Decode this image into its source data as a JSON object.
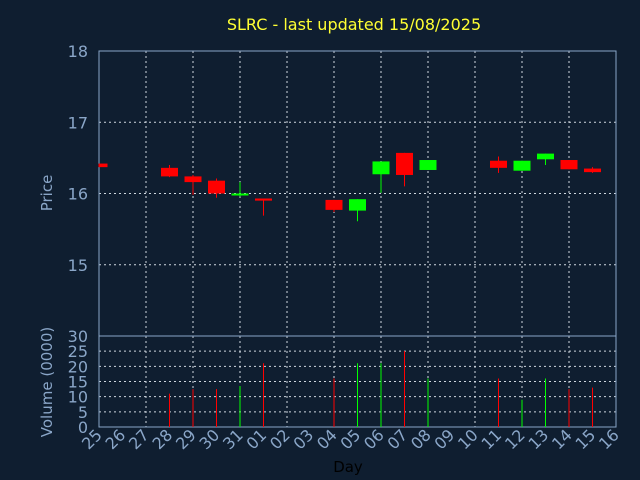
{
  "chart_data": {
    "type": "candlestick",
    "title": "SLRC - last updated 15/08/2025",
    "ylabel": "Price",
    "volume_ylabel": "Volume (0000)",
    "xlabel": "Day",
    "x_ticks": [
      "25",
      "26",
      "27",
      "28",
      "29",
      "30",
      "31",
      "01",
      "02",
      "03",
      "04",
      "05",
      "06",
      "07",
      "08",
      "09",
      "10",
      "11",
      "12",
      "13",
      "14",
      "15",
      "16"
    ],
    "price_ticks": [
      15,
      16,
      17,
      18
    ],
    "price_ylim": [
      14.0,
      18.0
    ],
    "volume_ticks": [
      0,
      5,
      10,
      15,
      20,
      25,
      30
    ],
    "volume_ylim": [
      0,
      30
    ],
    "grid": true,
    "colors": {
      "up": "#00ff00",
      "down": "#ff0000",
      "grid": "#d0d8e0",
      "frame": "#8aa6c8",
      "background": "#0f1e30"
    },
    "candles": [
      {
        "day": "25",
        "open": 16.42,
        "high": 16.42,
        "low": 16.37,
        "close": 16.37,
        "volume": null
      },
      {
        "day": "28",
        "open": 16.36,
        "high": 16.4,
        "low": 16.23,
        "close": 16.24,
        "volume": 11
      },
      {
        "day": "29",
        "open": 16.24,
        "high": 16.26,
        "low": 15.98,
        "close": 16.16,
        "volume": 12.5
      },
      {
        "day": "30",
        "open": 16.18,
        "high": 16.21,
        "low": 15.94,
        "close": 16.0,
        "volume": 12.5
      },
      {
        "day": "31",
        "open": 15.99,
        "high": 16.16,
        "low": 15.96,
        "close": 16.0,
        "volume": 13.5
      },
      {
        "day": "01",
        "open": 15.93,
        "high": 15.93,
        "low": 15.69,
        "close": 15.9,
        "volume": 21
      },
      {
        "day": "04",
        "open": 15.91,
        "high": 15.91,
        "low": 15.74,
        "close": 15.77,
        "volume": 16
      },
      {
        "day": "05",
        "open": 15.76,
        "high": 15.92,
        "low": 15.61,
        "close": 15.92,
        "volume": 21
      },
      {
        "day": "06",
        "open": 16.27,
        "high": 16.45,
        "low": 16.01,
        "close": 16.45,
        "volume": 21
      },
      {
        "day": "07",
        "open": 16.57,
        "high": 16.57,
        "low": 16.1,
        "close": 16.26,
        "volume": 25
      },
      {
        "day": "08",
        "open": 16.33,
        "high": 16.47,
        "low": 16.33,
        "close": 16.47,
        "volume": 16
      },
      {
        "day": "11",
        "open": 16.46,
        "high": 16.52,
        "low": 16.29,
        "close": 16.36,
        "volume": 16
      },
      {
        "day": "12",
        "open": 16.32,
        "high": 16.46,
        "low": 16.32,
        "close": 16.46,
        "volume": 9
      },
      {
        "day": "13",
        "open": 16.48,
        "high": 16.56,
        "low": 16.4,
        "close": 16.56,
        "volume": 16
      },
      {
        "day": "14",
        "open": 16.47,
        "high": 16.47,
        "low": 16.34,
        "close": 16.34,
        "volume": 12.5
      },
      {
        "day": "15",
        "open": 16.35,
        "high": 16.37,
        "low": 16.29,
        "close": 16.3,
        "volume": 13
      }
    ]
  }
}
